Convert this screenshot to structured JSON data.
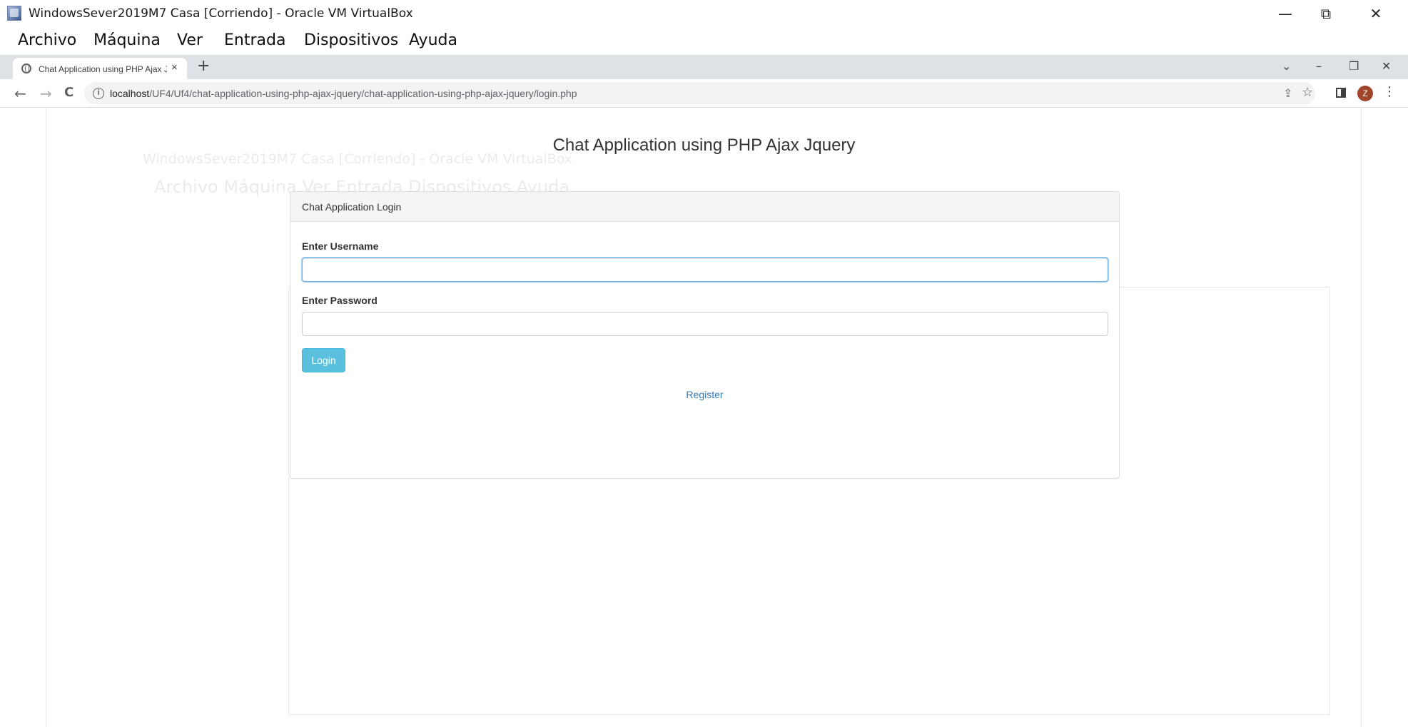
{
  "vbox": {
    "window_title": "WindowsSever2019M7 Casa [Corriendo] - Oracle VM VirtualBox",
    "controls": {
      "minimize": "—",
      "maximize": "⧉",
      "close": "✕"
    },
    "menu": [
      "Archivo",
      "Máquina",
      "Ver",
      "Entrada",
      "Dispositivos",
      "Ayuda"
    ]
  },
  "browser": {
    "tab_title": "Chat Application using PHP Ajax Jquery",
    "tab_close": "×",
    "new_tab": "+",
    "strip_controls": {
      "tab_search": "⌄",
      "minimize": "–",
      "restore": "❐",
      "close": "✕"
    },
    "nav": {
      "back": "←",
      "forward": "→",
      "reload": "C"
    },
    "url_host": "localhost",
    "url_path": "/UF4/Uf4/chat-application-using-php-ajax-jquery/chat-application-using-php-ajax-jquery/login.php",
    "icons": {
      "share": "⇪",
      "bookmark": "☆",
      "menu": "⋮"
    },
    "avatar_letter": "Z"
  },
  "ghost": {
    "title": "WindowsSever2019M7 Casa [Corriendo] - Oracle VM VirtualBox",
    "menu": "Archivo   Máquina   Ver   Entrada   Dispositivos   Ayuda"
  },
  "page": {
    "heading": "Chat Application using PHP Ajax Jquery",
    "panel_title": "Chat Application Login",
    "username_label": "Enter Username",
    "username_value": "",
    "password_label": "Enter Password",
    "password_value": "",
    "login_button": "Login",
    "register_link": "Register"
  },
  "colors": {
    "info_button": "#5bc0de",
    "link": "#337ab7",
    "focus_border": "#66afe9",
    "tabstrip": "#dee1e6"
  }
}
